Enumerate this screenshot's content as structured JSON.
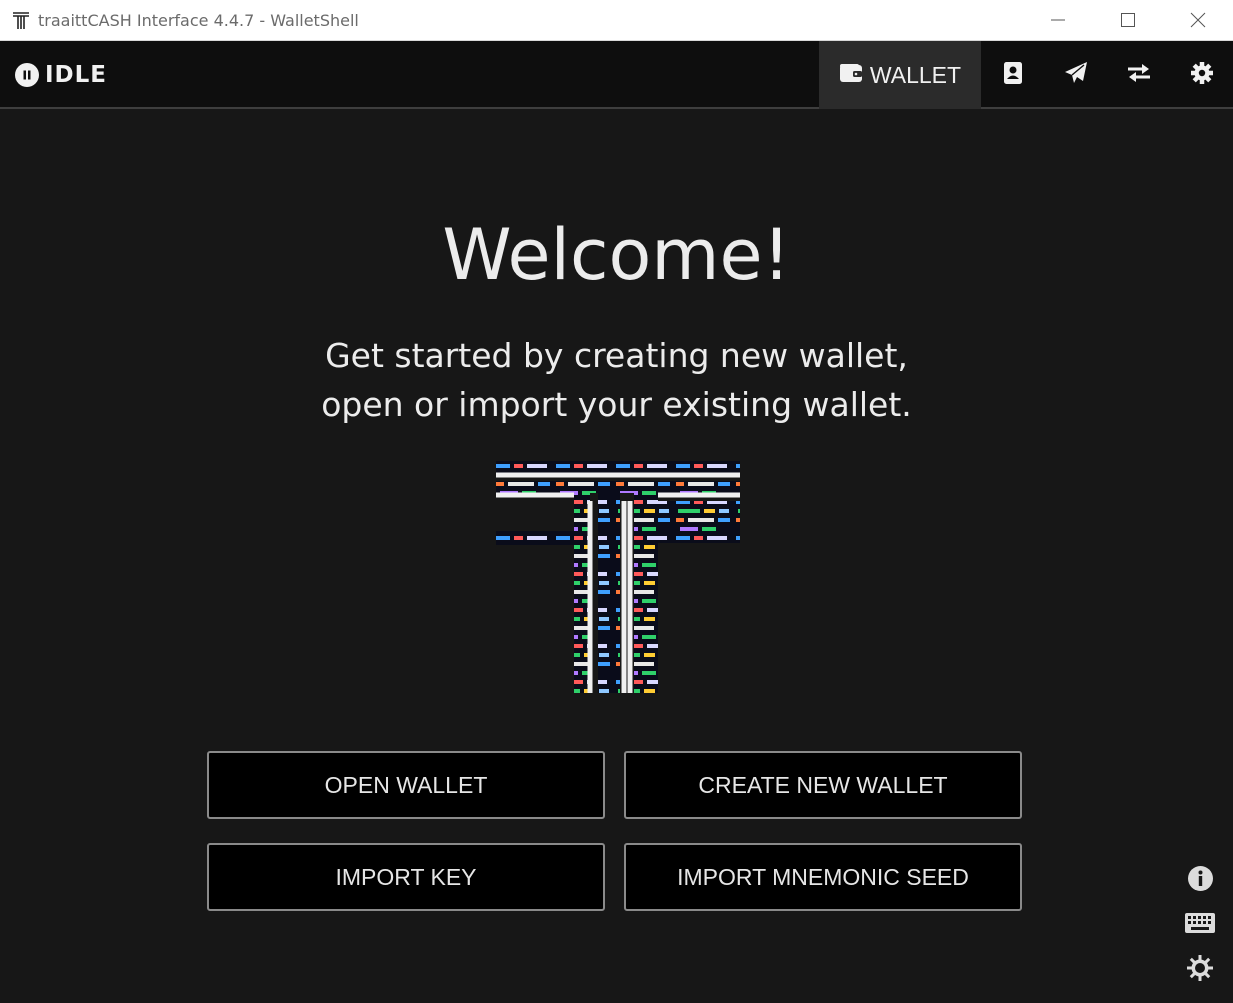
{
  "window": {
    "title": "traaittCASH Interface 4.4.7 - WalletShell",
    "app_icon": "traaitt-t-logo-icon",
    "controls": [
      "minimize-icon",
      "maximize-icon",
      "close-icon"
    ]
  },
  "topbar": {
    "status_label": "IDLE",
    "status_icon": "pause-circle-icon",
    "nav": {
      "wallet_label": "WALLET",
      "wallet_icon": "wallet-icon",
      "icons": [
        "address-book-icon",
        "send-icon",
        "transfer-arrows-icon",
        "gear-icon"
      ]
    }
  },
  "main": {
    "heading": "Welcome!",
    "subtitle_line1": "Get started by creating new wallet,",
    "subtitle_line2": "open or import your existing wallet.",
    "buttons": {
      "open": "OPEN WALLET",
      "create": "CREATE NEW WALLET",
      "import_key": "IMPORT KEY",
      "import_seed": "IMPORT MNEMONIC SEED"
    },
    "side_icons": [
      "info-icon",
      "keyboard-icon",
      "brightness-icon"
    ]
  },
  "colors": {
    "background": "#171717",
    "topbar": "#0e0e0e",
    "active_tab": "#2b2b2b",
    "button_border": "#8a8a8a",
    "text": "#ececec"
  }
}
